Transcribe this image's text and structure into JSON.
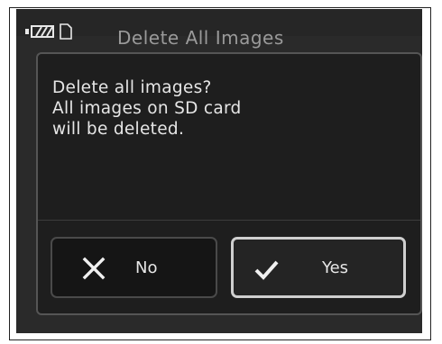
{
  "screen": {
    "title": "Delete All Images",
    "status": {
      "battery": "battery-icon",
      "card": "sd-card-icon"
    }
  },
  "dialog": {
    "message_lines": [
      "Delete all images?",
      "All images on SD card",
      "will be deleted."
    ],
    "buttons": {
      "no": {
        "label": "No",
        "icon": "close-icon"
      },
      "yes": {
        "label": "Yes",
        "icon": "checkmark-icon",
        "selected": true
      }
    }
  },
  "colors": {
    "background": "#1e1e1e",
    "text": "#e6e6e6",
    "selected_border": "#cfcfcf"
  }
}
